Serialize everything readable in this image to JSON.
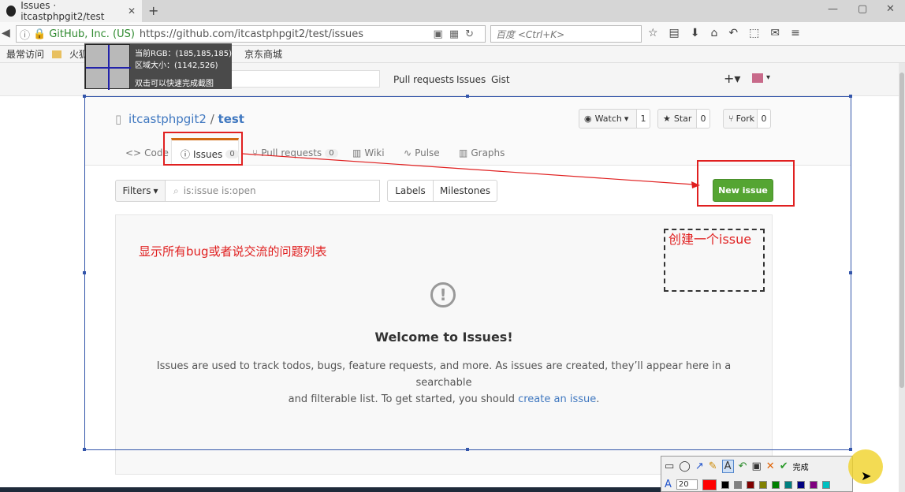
{
  "browser": {
    "tab_title": "Issues · itcastphpgit2/test",
    "identity": "GitHub, Inc. (US)",
    "url": "https://github.com/itcastphpgit2/test/issues",
    "search_placeholder": "百度 <Ctrl+K>"
  },
  "bookmarks": [
    "最常访问",
    "火狐官方",
    "京东商城"
  ],
  "screenshot_tool": {
    "rgb_label": "当前RGB：(185,185,185)",
    "size_label": "区域大小：(1142,526)",
    "hint": "双击可以快速完成截图",
    "done_label": "完成",
    "font_size": "20"
  },
  "github_header": {
    "links": [
      "Pull requests",
      "Issues",
      "Gist"
    ]
  },
  "repo": {
    "owner": "itcastphpgit2",
    "separator": "/",
    "name": "test",
    "watch_label": "Watch",
    "watch_count": "1",
    "star_label": "Star",
    "star_count": "0",
    "fork_label": "Fork",
    "fork_count": "0"
  },
  "tabs": {
    "code": "Code",
    "issues": "Issues",
    "issues_count": "0",
    "pulls": "Pull requests",
    "pulls_count": "0",
    "wiki": "Wiki",
    "pulse": "Pulse",
    "graphs": "Graphs"
  },
  "filter_bar": {
    "filters_label": "Filters",
    "query": "is:issue is:open",
    "labels_label": "Labels",
    "milestones_label": "Milestones",
    "new_issue_label": "New issue"
  },
  "annotations": {
    "list_note": "显示所有bug或者说交流的问题列表",
    "create_note": "创建一个issue"
  },
  "blankslate": {
    "title": "Welcome to Issues!",
    "line1": "Issues are used to track todos, bugs, feature requests, and more. As issues are created, they’ll appear here in a searchable",
    "line2_a": "and filterable list. To get started, you should",
    "link": "create an issue",
    "line2_b": "."
  },
  "colors": {
    "accent_red": "#e02020",
    "github_link": "#4078c0",
    "new_issue_green": "#55a532",
    "tab_orange": "#d26911"
  }
}
